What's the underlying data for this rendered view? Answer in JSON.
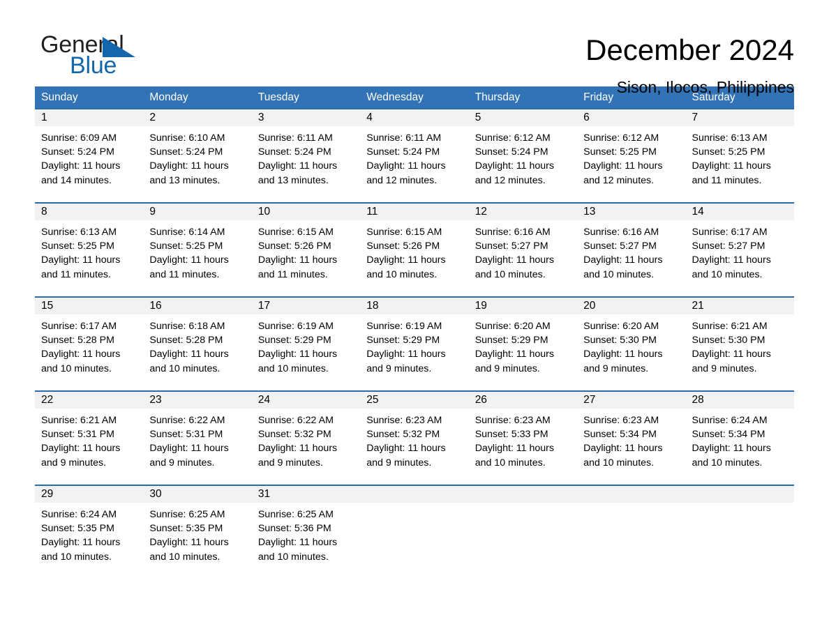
{
  "logo": {
    "word1": "General",
    "word2": "Blue",
    "triangle_color": "#1267ac",
    "text_color": "#231f20"
  },
  "header": {
    "month_title": "December 2024",
    "location": "Sison, Ilocos, Philippines"
  },
  "calendar": {
    "header_bg": "#3273b5",
    "row_divider_color": "#2b6cb0",
    "daynum_band_bg": "#f2f2f2",
    "weekdays": [
      "Sunday",
      "Monday",
      "Tuesday",
      "Wednesday",
      "Thursday",
      "Friday",
      "Saturday"
    ],
    "weeks": [
      [
        {
          "day": "1",
          "sunrise": "Sunrise: 6:09 AM",
          "sunset": "Sunset: 5:24 PM",
          "daylight_line1": "Daylight: 11 hours",
          "daylight_line2": "and 14 minutes."
        },
        {
          "day": "2",
          "sunrise": "Sunrise: 6:10 AM",
          "sunset": "Sunset: 5:24 PM",
          "daylight_line1": "Daylight: 11 hours",
          "daylight_line2": "and 13 minutes."
        },
        {
          "day": "3",
          "sunrise": "Sunrise: 6:11 AM",
          "sunset": "Sunset: 5:24 PM",
          "daylight_line1": "Daylight: 11 hours",
          "daylight_line2": "and 13 minutes."
        },
        {
          "day": "4",
          "sunrise": "Sunrise: 6:11 AM",
          "sunset": "Sunset: 5:24 PM",
          "daylight_line1": "Daylight: 11 hours",
          "daylight_line2": "and 12 minutes."
        },
        {
          "day": "5",
          "sunrise": "Sunrise: 6:12 AM",
          "sunset": "Sunset: 5:24 PM",
          "daylight_line1": "Daylight: 11 hours",
          "daylight_line2": "and 12 minutes."
        },
        {
          "day": "6",
          "sunrise": "Sunrise: 6:12 AM",
          "sunset": "Sunset: 5:25 PM",
          "daylight_line1": "Daylight: 11 hours",
          "daylight_line2": "and 12 minutes."
        },
        {
          "day": "7",
          "sunrise": "Sunrise: 6:13 AM",
          "sunset": "Sunset: 5:25 PM",
          "daylight_line1": "Daylight: 11 hours",
          "daylight_line2": "and 11 minutes."
        }
      ],
      [
        {
          "day": "8",
          "sunrise": "Sunrise: 6:13 AM",
          "sunset": "Sunset: 5:25 PM",
          "daylight_line1": "Daylight: 11 hours",
          "daylight_line2": "and 11 minutes."
        },
        {
          "day": "9",
          "sunrise": "Sunrise: 6:14 AM",
          "sunset": "Sunset: 5:25 PM",
          "daylight_line1": "Daylight: 11 hours",
          "daylight_line2": "and 11 minutes."
        },
        {
          "day": "10",
          "sunrise": "Sunrise: 6:15 AM",
          "sunset": "Sunset: 5:26 PM",
          "daylight_line1": "Daylight: 11 hours",
          "daylight_line2": "and 11 minutes."
        },
        {
          "day": "11",
          "sunrise": "Sunrise: 6:15 AM",
          "sunset": "Sunset: 5:26 PM",
          "daylight_line1": "Daylight: 11 hours",
          "daylight_line2": "and 10 minutes."
        },
        {
          "day": "12",
          "sunrise": "Sunrise: 6:16 AM",
          "sunset": "Sunset: 5:27 PM",
          "daylight_line1": "Daylight: 11 hours",
          "daylight_line2": "and 10 minutes."
        },
        {
          "day": "13",
          "sunrise": "Sunrise: 6:16 AM",
          "sunset": "Sunset: 5:27 PM",
          "daylight_line1": "Daylight: 11 hours",
          "daylight_line2": "and 10 minutes."
        },
        {
          "day": "14",
          "sunrise": "Sunrise: 6:17 AM",
          "sunset": "Sunset: 5:27 PM",
          "daylight_line1": "Daylight: 11 hours",
          "daylight_line2": "and 10 minutes."
        }
      ],
      [
        {
          "day": "15",
          "sunrise": "Sunrise: 6:17 AM",
          "sunset": "Sunset: 5:28 PM",
          "daylight_line1": "Daylight: 11 hours",
          "daylight_line2": "and 10 minutes."
        },
        {
          "day": "16",
          "sunrise": "Sunrise: 6:18 AM",
          "sunset": "Sunset: 5:28 PM",
          "daylight_line1": "Daylight: 11 hours",
          "daylight_line2": "and 10 minutes."
        },
        {
          "day": "17",
          "sunrise": "Sunrise: 6:19 AM",
          "sunset": "Sunset: 5:29 PM",
          "daylight_line1": "Daylight: 11 hours",
          "daylight_line2": "and 10 minutes."
        },
        {
          "day": "18",
          "sunrise": "Sunrise: 6:19 AM",
          "sunset": "Sunset: 5:29 PM",
          "daylight_line1": "Daylight: 11 hours",
          "daylight_line2": "and 9 minutes."
        },
        {
          "day": "19",
          "sunrise": "Sunrise: 6:20 AM",
          "sunset": "Sunset: 5:29 PM",
          "daylight_line1": "Daylight: 11 hours",
          "daylight_line2": "and 9 minutes."
        },
        {
          "day": "20",
          "sunrise": "Sunrise: 6:20 AM",
          "sunset": "Sunset: 5:30 PM",
          "daylight_line1": "Daylight: 11 hours",
          "daylight_line2": "and 9 minutes."
        },
        {
          "day": "21",
          "sunrise": "Sunrise: 6:21 AM",
          "sunset": "Sunset: 5:30 PM",
          "daylight_line1": "Daylight: 11 hours",
          "daylight_line2": "and 9 minutes."
        }
      ],
      [
        {
          "day": "22",
          "sunrise": "Sunrise: 6:21 AM",
          "sunset": "Sunset: 5:31 PM",
          "daylight_line1": "Daylight: 11 hours",
          "daylight_line2": "and 9 minutes."
        },
        {
          "day": "23",
          "sunrise": "Sunrise: 6:22 AM",
          "sunset": "Sunset: 5:31 PM",
          "daylight_line1": "Daylight: 11 hours",
          "daylight_line2": "and 9 minutes."
        },
        {
          "day": "24",
          "sunrise": "Sunrise: 6:22 AM",
          "sunset": "Sunset: 5:32 PM",
          "daylight_line1": "Daylight: 11 hours",
          "daylight_line2": "and 9 minutes."
        },
        {
          "day": "25",
          "sunrise": "Sunrise: 6:23 AM",
          "sunset": "Sunset: 5:32 PM",
          "daylight_line1": "Daylight: 11 hours",
          "daylight_line2": "and 9 minutes."
        },
        {
          "day": "26",
          "sunrise": "Sunrise: 6:23 AM",
          "sunset": "Sunset: 5:33 PM",
          "daylight_line1": "Daylight: 11 hours",
          "daylight_line2": "and 10 minutes."
        },
        {
          "day": "27",
          "sunrise": "Sunrise: 6:23 AM",
          "sunset": "Sunset: 5:34 PM",
          "daylight_line1": "Daylight: 11 hours",
          "daylight_line2": "and 10 minutes."
        },
        {
          "day": "28",
          "sunrise": "Sunrise: 6:24 AM",
          "sunset": "Sunset: 5:34 PM",
          "daylight_line1": "Daylight: 11 hours",
          "daylight_line2": "and 10 minutes."
        }
      ],
      [
        {
          "day": "29",
          "sunrise": "Sunrise: 6:24 AM",
          "sunset": "Sunset: 5:35 PM",
          "daylight_line1": "Daylight: 11 hours",
          "daylight_line2": "and 10 minutes."
        },
        {
          "day": "30",
          "sunrise": "Sunrise: 6:25 AM",
          "sunset": "Sunset: 5:35 PM",
          "daylight_line1": "Daylight: 11 hours",
          "daylight_line2": "and 10 minutes."
        },
        {
          "day": "31",
          "sunrise": "Sunrise: 6:25 AM",
          "sunset": "Sunset: 5:36 PM",
          "daylight_line1": "Daylight: 11 hours",
          "daylight_line2": "and 10 minutes."
        },
        {
          "day": "",
          "sunrise": "",
          "sunset": "",
          "daylight_line1": "",
          "daylight_line2": ""
        },
        {
          "day": "",
          "sunrise": "",
          "sunset": "",
          "daylight_line1": "",
          "daylight_line2": ""
        },
        {
          "day": "",
          "sunrise": "",
          "sunset": "",
          "daylight_line1": "",
          "daylight_line2": ""
        },
        {
          "day": "",
          "sunrise": "",
          "sunset": "",
          "daylight_line1": "",
          "daylight_line2": ""
        }
      ]
    ]
  }
}
